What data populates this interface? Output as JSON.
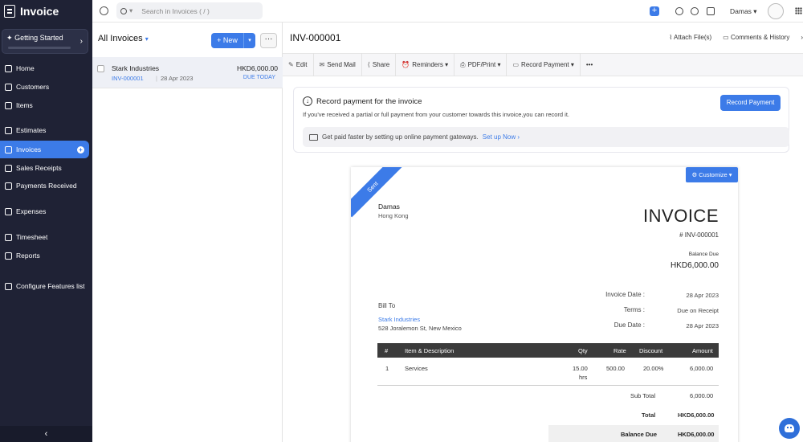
{
  "app": {
    "title": "Invoice"
  },
  "sidebar": {
    "getting_started": "Getting Started",
    "items": [
      {
        "label": "Home"
      },
      {
        "label": "Customers"
      },
      {
        "label": "Items"
      },
      {
        "label": "Estimates"
      },
      {
        "label": "Invoices"
      },
      {
        "label": "Sales Receipts"
      },
      {
        "label": "Payments Received"
      },
      {
        "label": "Expenses"
      },
      {
        "label": "Timesheet"
      },
      {
        "label": "Reports"
      },
      {
        "label": "Configure Features list"
      }
    ],
    "collapse": "‹"
  },
  "topbar": {
    "search_placeholder": "Search in Invoices ( / )",
    "add": "+",
    "org": "Damas ▾",
    "accent": "#3c7be8"
  },
  "list": {
    "title": "All Invoices",
    "new_label": "+ New",
    "more": "···",
    "rows": [
      {
        "customer": "Stark Industries",
        "amount": "HKD6,000.00",
        "number": "INV-000001",
        "date": "28 Apr 2023",
        "status": "DUE TODAY"
      }
    ]
  },
  "detail": {
    "title": "INV-000001",
    "attach": "Attach File(s)",
    "comments": "Comments & History",
    "actions": [
      {
        "icon": "✎",
        "label": "Edit"
      },
      {
        "icon": "✉",
        "label": "Send Mail"
      },
      {
        "icon": "⟨",
        "label": "Share"
      },
      {
        "icon": "⏰",
        "label": "Reminders ▾"
      },
      {
        "icon": "⎙",
        "label": "PDF/Print ▾"
      },
      {
        "icon": "▭",
        "label": "Record Payment ▾"
      },
      {
        "icon": "",
        "label": "•••"
      }
    ],
    "record_payment": {
      "title": "Record payment for the invoice",
      "text": "If you've received a partial or full payment from your customer towards this invoice,you can record it.",
      "button": "Record Payment",
      "gateway_text": "Get paid faster by setting up online payment gateways.",
      "gateway_link": "Set up Now ›"
    }
  },
  "invoice": {
    "ribbon": "Sent",
    "customize": "⚙ Customize ▾",
    "org_name": "Damas",
    "org_address": "Hong Kong",
    "heading": "INVOICE",
    "number": "# INV-000001",
    "balance_due_label": "Balance Due",
    "balance_due": "HKD6,000.00",
    "invoice_date_label": "Invoice Date :",
    "invoice_date": "28 Apr 2023",
    "terms_label": "Terms :",
    "terms": "Due on Receipt",
    "due_date_label": "Due Date :",
    "due_date": "28 Apr 2023",
    "bill_to": "Bill To",
    "bill_name": "Stark Industries",
    "bill_address": "528 Joralemon St, New Mexico",
    "columns": [
      "#",
      "Item & Description",
      "Qty",
      "Rate",
      "Discount",
      "Amount"
    ],
    "lines": [
      {
        "no": "1",
        "desc": "Services",
        "qty": "15.00",
        "unit": "hrs",
        "rate": "500.00",
        "discount": "20.00%",
        "amount": "6,000.00"
      }
    ],
    "sub_total_label": "Sub Total",
    "sub_total": "6,000.00",
    "total_label": "Total",
    "total": "HKD6,000.00",
    "balance_label": "Balance Due",
    "balance": "HKD6,000.00"
  }
}
